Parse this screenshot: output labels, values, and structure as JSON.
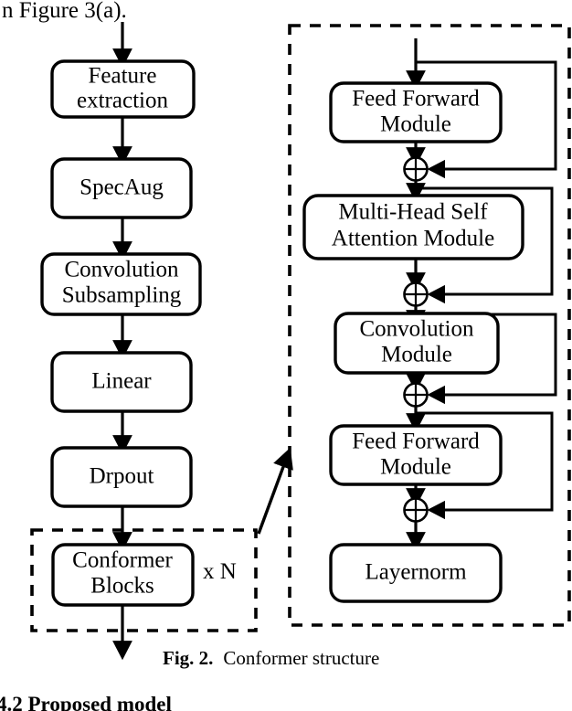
{
  "page": {
    "top_text": "n Figure 3(a).",
    "bottom_heading": "4.2 Proposed model"
  },
  "caption": {
    "prefix": "Fig. 2.",
    "text": "Conformer structure"
  },
  "left_pipeline": {
    "name": "encoder-pipeline",
    "nodes": [
      {
        "id": "feature-extraction",
        "lines": [
          "Feature",
          "extraction"
        ]
      },
      {
        "id": "specaug",
        "lines": [
          "SpecAug"
        ]
      },
      {
        "id": "convolution-subsampling",
        "lines": [
          "Convolution",
          "Subsampling"
        ]
      },
      {
        "id": "linear",
        "lines": [
          "Linear"
        ]
      },
      {
        "id": "dropout",
        "lines": [
          "Drpout"
        ]
      },
      {
        "id": "conformer-blocks",
        "lines": [
          "Conformer",
          "Blocks"
        ]
      }
    ],
    "repeat_label": "x N",
    "group_label": "conformer-blocks-group"
  },
  "conformer_block": {
    "name": "conformer-block-detail",
    "nodes": [
      {
        "id": "feed-forward-module-1",
        "lines": [
          "Feed Forward",
          "Module"
        ]
      },
      {
        "id": "multi-head-self-attention-module",
        "lines": [
          "Multi-Head Self",
          "Attention Module"
        ]
      },
      {
        "id": "convolution-module",
        "lines": [
          "Convolution",
          "Module"
        ]
      },
      {
        "id": "feed-forward-module-2",
        "lines": [
          "Feed Forward",
          "Module"
        ]
      },
      {
        "id": "layernorm",
        "lines": [
          "Layernorm"
        ]
      }
    ],
    "residual_operator": "add-operator",
    "residual_count": 4
  },
  "colors": {
    "stroke": "#000000",
    "fill": "#ffffff",
    "background": "#ffffff"
  }
}
